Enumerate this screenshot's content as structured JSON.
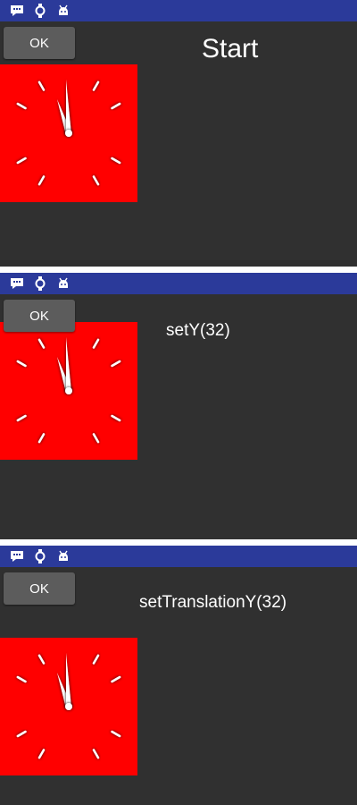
{
  "colors": {
    "status_bar": "#2b3a9a",
    "background": "#303030",
    "clock_face": "#ff0000",
    "button": "#5c5c5c"
  },
  "status_icons": [
    "message-icon",
    "watch-icon",
    "android-icon"
  ],
  "panels": [
    {
      "button_label": "OK",
      "caption": "Start"
    },
    {
      "button_label": "OK",
      "caption": "setY(32)"
    },
    {
      "button_label": "OK",
      "caption": "setTranslationY(32)"
    }
  ]
}
